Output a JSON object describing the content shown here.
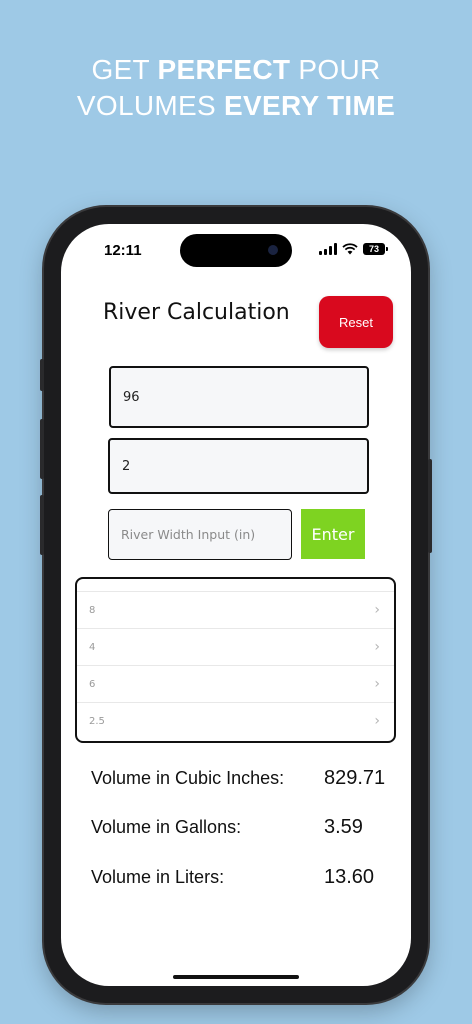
{
  "promo": {
    "line1_pre": "GET ",
    "line1_bold": "PERFECT",
    "line1_post": " POUR",
    "line2_pre": "VOLUMES ",
    "line2_bold": "EVERY TIME"
  },
  "status": {
    "time": "12:11",
    "battery": "73"
  },
  "header": {
    "title": "River Calculation",
    "reset_label": "Reset"
  },
  "inputs": {
    "first_value": "96",
    "second_value": "2",
    "width_placeholder": "River Width Input (in)",
    "enter_label": "Enter"
  },
  "list_items": [
    "8",
    "4",
    "6",
    "2.5"
  ],
  "results": [
    {
      "label": "Volume in Cubic Inches:",
      "value": "829.71"
    },
    {
      "label": "Volume in Gallons:",
      "value": "3.59"
    },
    {
      "label": "Volume in Liters:",
      "value": "13.60"
    }
  ],
  "colors": {
    "background": "#9ec9e6",
    "reset": "#d9091e",
    "enter": "#7ed321"
  }
}
